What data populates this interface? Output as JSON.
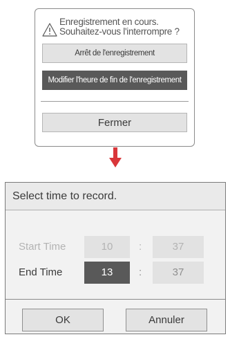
{
  "stop_dialog": {
    "message_line1": "Enregistrement en cours.",
    "message_line2": "Souhaitez-vous l'interrompre ?",
    "buttons": {
      "stop_recording": "Arrêt de l'enregistrement",
      "modify_end_time": "Modifier l'heure de fin de l'enregistrement",
      "close": "Fermer"
    },
    "icon": "warning-triangle-icon"
  },
  "transition_arrow": {
    "icon": "arrow-down-icon",
    "color": "#d9363a"
  },
  "time_dialog": {
    "title": "Select time to record.",
    "start_time": {
      "label": "Start Time",
      "hour": "10",
      "minute": "37"
    },
    "end_time": {
      "label": "End Time",
      "hour": "13",
      "minute": "37"
    },
    "separator": ":",
    "buttons": {
      "ok": "OK",
      "cancel": "Annuler"
    }
  },
  "colors": {
    "selected_bg": "#595959",
    "button_bg": "#e3e3e3",
    "disabled_text": "#b3b3b3",
    "arrow_red": "#d9363a"
  }
}
